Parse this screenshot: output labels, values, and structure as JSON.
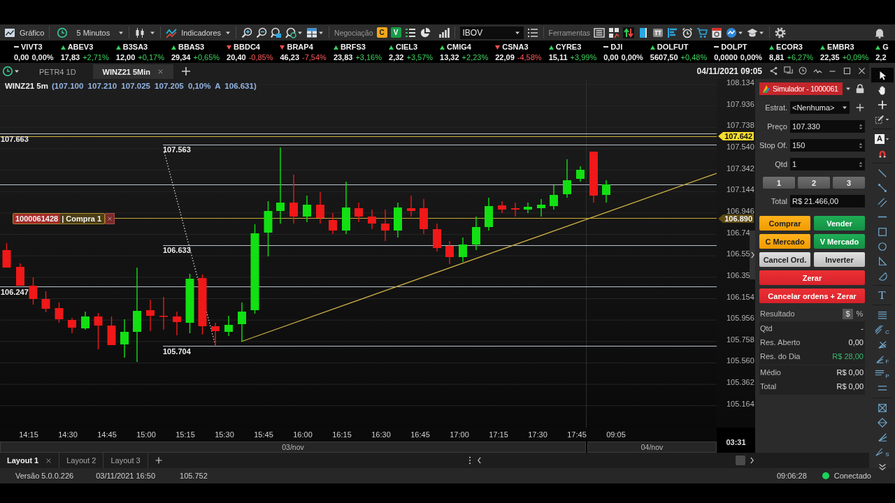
{
  "toolbar": {
    "chart_label": "Gráfico",
    "interval": "5 Minutos",
    "indicators_label": "Indicadores",
    "trading_label": "Negociação",
    "trade_badges": [
      {
        "letter": "C",
        "kind": "buy"
      },
      {
        "letter": "V",
        "kind": "sell"
      }
    ],
    "symbol": "IBOV",
    "tools_label": "Ferramentas"
  },
  "ticker": [
    {
      "symbol": "VIVT3",
      "price": "0,00",
      "change": "0,00%",
      "kind": "flat"
    },
    {
      "symbol": "ABEV3",
      "price": "17,83",
      "change": "+2,71%",
      "kind": "up"
    },
    {
      "symbol": "B3SA3",
      "price": "12,00",
      "change": "+0,17%",
      "kind": "up"
    },
    {
      "symbol": "BBAS3",
      "price": "29,34",
      "change": "+0,65%",
      "kind": "up"
    },
    {
      "symbol": "BBDC4",
      "price": "20,40",
      "change": "-0,85%",
      "kind": "down"
    },
    {
      "symbol": "BRAP4",
      "price": "46,23",
      "change": "-7,54%",
      "kind": "down"
    },
    {
      "symbol": "BRFS3",
      "price": "23,83",
      "change": "+3,16%",
      "kind": "up"
    },
    {
      "symbol": "CIEL3",
      "price": "2,32",
      "change": "+3,57%",
      "kind": "up"
    },
    {
      "symbol": "CMIG4",
      "price": "13,32",
      "change": "+2,23%",
      "kind": "up"
    },
    {
      "symbol": "CSNA3",
      "price": "22,09",
      "change": "-4,58%",
      "kind": "down"
    },
    {
      "symbol": "CYRE3",
      "price": "15,11",
      "change": "+3,99%",
      "kind": "up"
    },
    {
      "symbol": "DJI",
      "price": "0,00",
      "change": "0,00%",
      "kind": "flat"
    },
    {
      "symbol": "DOLFUT",
      "price": "5607,50",
      "change": "+0,48%",
      "kind": "up"
    },
    {
      "symbol": "DOLPT",
      "price": "0,0000",
      "change": "0,00%",
      "kind": "flat"
    },
    {
      "symbol": "ECOR3",
      "price": "8,81",
      "change": "+6,27%",
      "kind": "up"
    },
    {
      "symbol": "EMBR3",
      "price": "22,35",
      "change": "+0,09%",
      "kind": "up"
    },
    {
      "symbol": "G",
      "price": "2,2",
      "kind": "up"
    }
  ],
  "chart_tabs": [
    {
      "label": "PETR4 1D",
      "selected": false
    },
    {
      "label": "WINZ21 5Min",
      "selected": true
    }
  ],
  "chart_datetime": "04/11/2021 09:05",
  "chart": {
    "symbol": "WINZ21 5m",
    "quote": "(107.100 107.210 107.025 107.205 0,10% A 106.631)",
    "price_axis": [
      "108.134",
      "107.936",
      "107.738",
      "107.540",
      "107.342",
      "107.144",
      "106.946",
      "106.74",
      "106.55",
      "106.35",
      "106.154",
      "105.956",
      "105.758",
      "105.560",
      "105.362",
      "105.164"
    ],
    "price_tags": [
      {
        "label": "107.642",
        "kind": "alert"
      },
      {
        "label": "106.890",
        "kind": "order"
      }
    ],
    "levels": [
      "107.663",
      "107.563",
      "106.633",
      "106.247",
      "105.704"
    ],
    "order": {
      "id": "1000061428",
      "side": "| Compra 1"
    },
    "time_axis": [
      "14:15",
      "14:30",
      "14:45",
      "15:00",
      "15:15",
      "15:30",
      "15:45",
      "16:00",
      "16:15",
      "16:30",
      "16:45",
      "17:00",
      "17:15",
      "17:30",
      "17:45",
      "09:05"
    ],
    "days": [
      "03/nov",
      "04/nov"
    ],
    "countdown": "03:31"
  },
  "order_panel": {
    "account": "Simulador - 1000061",
    "fields": [
      {
        "label": "Estrat.",
        "value": "<Nenhuma>",
        "kind": "select"
      },
      {
        "label": "Preço",
        "value": "107.330",
        "kind": "spinner"
      },
      {
        "label": "Stop Of.",
        "value": "150",
        "kind": "spinner"
      },
      {
        "label": "Qtd",
        "value": "1",
        "kind": "spinner"
      }
    ],
    "quantity_presets": [
      "1",
      "2",
      "3"
    ],
    "total": {
      "label": "Total",
      "value": "R$ 21.466,00"
    },
    "actions": [
      {
        "label": "Comprar",
        "kind": "buy"
      },
      {
        "label": "Vender",
        "kind": "sell"
      },
      {
        "label": "C Mercado",
        "kind": "buy"
      },
      {
        "label": "V Mercado",
        "kind": "sell"
      },
      {
        "label": "Cancel Ord.",
        "kind": "neutral"
      },
      {
        "label": "Inverter",
        "kind": "neutral"
      },
      {
        "label": "Zerar",
        "kind": "danger"
      },
      {
        "label": "Cancelar ordens + Zerar",
        "kind": "danger"
      }
    ],
    "result": {
      "title": "Resultado",
      "units": [
        {
          "label": "$",
          "selected": true
        },
        {
          "label": "%",
          "selected": false
        }
      ],
      "rows": [
        {
          "label": "Qtd",
          "value": "-",
          "kind": "plain"
        },
        {
          "label": "Res. Aberto",
          "value": "0,00",
          "kind": "plain"
        },
        {
          "label": "Res. do Dia",
          "value": "R$ 28,00",
          "kind": "profit"
        }
      ],
      "summary": [
        {
          "label": "Médio",
          "value": "R$ 0,00"
        },
        {
          "label": "Total",
          "value": "R$ 0,00"
        }
      ]
    }
  },
  "layouts": [
    {
      "label": "Layout 1",
      "selected": true
    },
    {
      "label": "Layout 2",
      "selected": false
    },
    {
      "label": "Layout 3",
      "selected": false
    }
  ],
  "tools": [
    {
      "kind": "icon",
      "selected": true
    },
    {
      "kind": "icon",
      "selected": false
    },
    {
      "kind": "icon",
      "selected": false
    },
    {
      "kind": "icon",
      "selected": false
    },
    {
      "kind": "boxed",
      "glyph": "A",
      "selected": false
    },
    {
      "kind": "icon",
      "selected": false
    },
    {
      "kind": "icon",
      "selected": false
    },
    {
      "kind": "icon",
      "selected": false
    },
    {
      "kind": "icon",
      "selected": false
    },
    {
      "kind": "icon",
      "selected": false
    },
    {
      "kind": "icon",
      "selected": false
    },
    {
      "kind": "icon",
      "selected": false
    },
    {
      "kind": "icon",
      "selected": false
    },
    {
      "kind": "icon",
      "selected": false
    },
    {
      "kind": "letter",
      "glyph": "T",
      "selected": false
    },
    {
      "kind": "icon",
      "selected": false
    },
    {
      "kind": "subscript",
      "glyph": "C",
      "selected": false
    },
    {
      "kind": "icon",
      "selected": false
    },
    {
      "kind": "subscript",
      "glyph": "F",
      "selected": false
    },
    {
      "kind": "subscript",
      "glyph": "P",
      "selected": false
    },
    {
      "kind": "icon",
      "selected": false
    },
    {
      "kind": "icon",
      "selected": false
    },
    {
      "kind": "icon",
      "selected": false
    },
    {
      "kind": "icon",
      "selected": false
    },
    {
      "kind": "subscript",
      "glyph": "S",
      "selected": false
    },
    {
      "kind": "icon",
      "selected": false
    }
  ],
  "status_bar": {
    "version": "Versão 5.0.0.226",
    "timestamp": "03/11/2021 16:50",
    "last_price": "105.752",
    "clock": "09:06:28",
    "connection": "Conectado",
    "connected": true
  }
}
